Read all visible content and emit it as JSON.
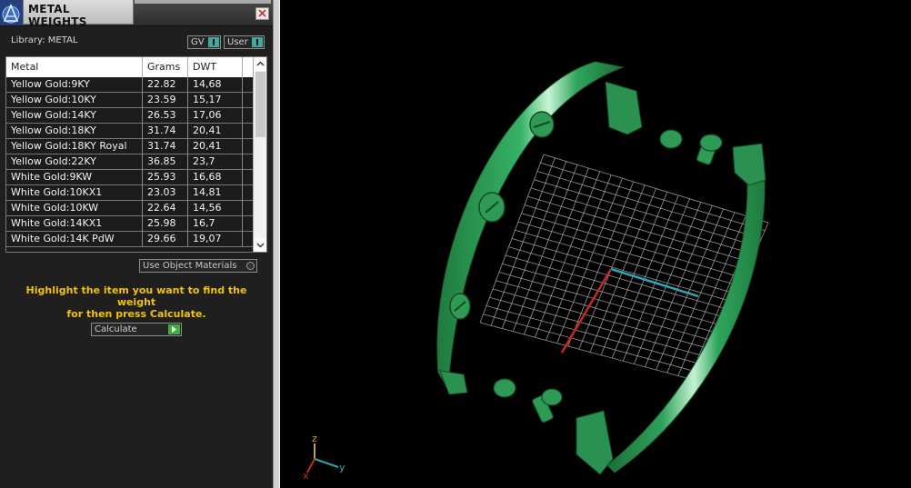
{
  "panel": {
    "title": "METAL WEIGHTS",
    "library_label": "Library: METAL",
    "toggle_gv": "GV",
    "toggle_user": "User",
    "columns": [
      "Metal",
      "Grams",
      "DWT"
    ],
    "rows": [
      [
        "Yellow Gold:9KY",
        "22.82",
        "14,68"
      ],
      [
        "Yellow Gold:10KY",
        "23.59",
        "15,17"
      ],
      [
        "Yellow Gold:14KY",
        "26.53",
        "17,06"
      ],
      [
        "Yellow Gold:18KY",
        "31.74",
        "20,41"
      ],
      [
        "Yellow Gold:18KY Royal",
        "31.74",
        "20,41"
      ],
      [
        "Yellow Gold:22KY",
        "36.85",
        "23,7"
      ],
      [
        "White Gold:9KW",
        "25.93",
        "16,68"
      ],
      [
        "White Gold:10KX1",
        "23.03",
        "14,81"
      ],
      [
        "White Gold:10KW",
        "22.64",
        "14,56"
      ],
      [
        "White Gold:14KX1",
        "25.98",
        "16,7"
      ],
      [
        "White Gold:14K PdW",
        "29.66",
        "19,07"
      ]
    ],
    "use_object_materials": "Use Object Materials",
    "instructions": [
      "Highlight the item you want to find the weight",
      "for then press Calculate."
    ],
    "calculate_label": "Calculate"
  },
  "viewport": {
    "axes": {
      "x": "x",
      "y": "y",
      "z": "z"
    },
    "model_color": "#2e9a55",
    "grid_color": "#b0b0b0"
  },
  "icons": [
    "app-logo-icon",
    "close-icon",
    "scroll-up-icon",
    "scroll-down-icon",
    "calculate-arrow-icon",
    "radio-icon"
  ]
}
